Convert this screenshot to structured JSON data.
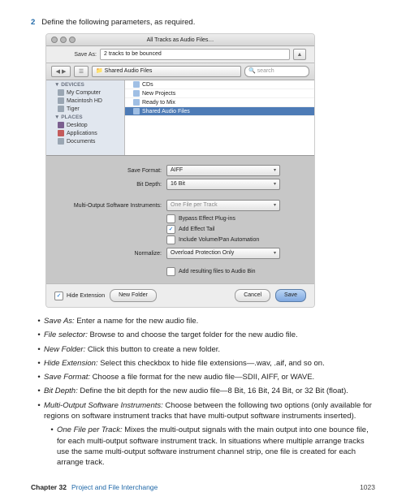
{
  "step": {
    "num": "2",
    "text": "Define the following parameters, as required."
  },
  "dlg": {
    "title": "All Tracks as Audio Files…",
    "saveAsLabel": "Save As:",
    "saveAsValue": "2 tracks to be bounced",
    "path": "Shared Audio Files",
    "searchPH": "search",
    "sb": {
      "devices": "DEVICES",
      "places": "PLACES",
      "dev": [
        "My Computer",
        "Macintosh HD",
        "Tiger"
      ],
      "pl": [
        "Desktop",
        "Applications",
        "Documents"
      ]
    },
    "files": [
      "CDs",
      "New Projects",
      "Ready to Mix",
      "Shared Audio Files"
    ],
    "p": {
      "saveFormatL": "Save Format:",
      "saveFormatV": "AIFF",
      "bitDepthL": "Bit Depth:",
      "bitDepthV": "16 Bit",
      "multiL": "Multi-Output Software Instruments:",
      "multiV": "One File per Track",
      "bypass": "Bypass Effect Plug-ins",
      "tail": "Add Effect Tail",
      "volpan": "Include Volume/Pan Automation",
      "normL": "Normalize:",
      "normV": "Overload Protection Only",
      "bin": "Add resulting files to Audio Bin"
    },
    "hideExt": "Hide Extension",
    "newFolder": "New Folder",
    "cancel": "Cancel",
    "save": "Save"
  },
  "b": [
    {
      "term": "Save As:",
      "text": "Enter a name for the new audio file."
    },
    {
      "term": "File selector:",
      "text": "Browse to and choose the target folder for the new audio file."
    },
    {
      "term": "New Folder:",
      "text": "Click this button to create a new folder."
    },
    {
      "term": "Hide Extension:",
      "text": "Select this checkbox to hide file extensions—.wav, .aif, and so on."
    },
    {
      "term": "Save Format:",
      "text": "Choose a file format for the new audio file—SDII, AIFF, or WAVE."
    },
    {
      "term": "Bit Depth:",
      "text": "Define the bit depth for the new audio file—8 Bit, 16 Bit, 24 Bit, or 32 Bit (float)."
    },
    {
      "term": "Multi-Output Software Instruments:",
      "text": "Choose between the following two options (only available for regions on software instrument tracks that have multi-output software instruments inserted)."
    }
  ],
  "sub": {
    "term": "One File per Track:",
    "text": "Mixes the multi-output signals with the main output into one bounce file, for each multi-output software instrument track. In situations where multiple arrange tracks use the same multi-output software instrument channel strip, one file is created for each arrange track."
  },
  "foot": {
    "ch": "Chapter 32",
    "ti": "Project and File Interchange",
    "pg": "1023"
  }
}
